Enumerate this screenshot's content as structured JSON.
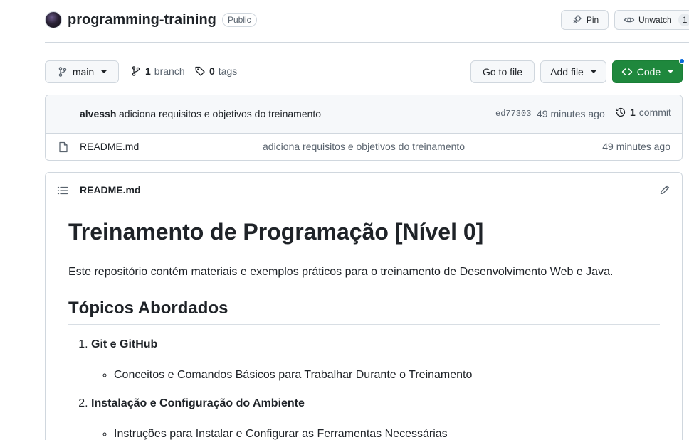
{
  "repo": {
    "name": "programming-training",
    "visibility": "Public",
    "pin_label": "Pin",
    "unwatch_label": "Unwatch",
    "watch_count": "1"
  },
  "nav": {
    "branch": "main",
    "branches_count": "1",
    "branches_label": "branch",
    "tags_count": "0",
    "tags_label": "tags",
    "goto_file": "Go to file",
    "add_file": "Add file",
    "code": "Code"
  },
  "commit": {
    "author": "alvessh",
    "message": "adiciona requisitos e objetivos do treinamento",
    "hash": "ed77303",
    "time": "49 minutes ago",
    "count": "1",
    "count_label": "commit"
  },
  "files": [
    {
      "name": "README.md",
      "commit_message": "adiciona requisitos e objetivos do treinamento",
      "time": "49 minutes ago"
    }
  ],
  "readme": {
    "filename": "README.md",
    "h1": "Treinamento de Programação [Nível 0]",
    "intro": "Este repositório contém materiais e exemplos práticos para o treinamento de Desenvolvimento Web e Java.",
    "h2": "Tópicos Abordados",
    "topics": [
      {
        "title": "Git e GitHub",
        "item": "Conceitos e Comandos Básicos para Trabalhar Durante o Treinamento"
      },
      {
        "title": "Instalação e Configuração do Ambiente",
        "item": "Instruções para Instalar e Configurar as Ferramentas Necessárias"
      }
    ]
  },
  "colors": {
    "primary_green": "#1f883d",
    "accent_blue": "#0969da",
    "border": "#d0d7de",
    "muted_text": "#59636e"
  },
  "icons": [
    "branch-icon",
    "tag-icon",
    "pin-icon",
    "eye-icon",
    "code-icon",
    "history-icon",
    "file-icon",
    "list-icon",
    "pencil-icon"
  ]
}
